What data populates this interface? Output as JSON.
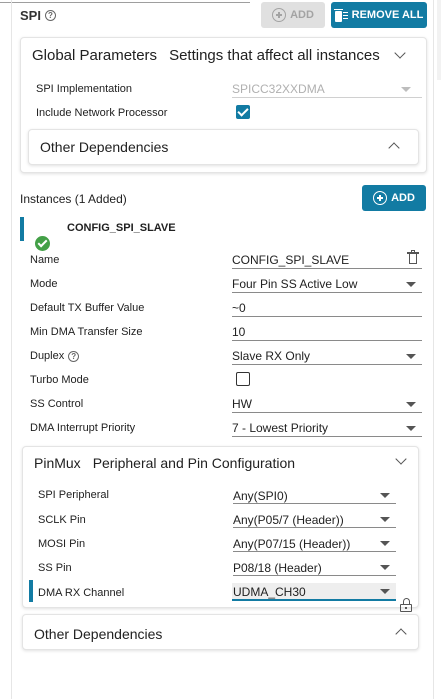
{
  "header": {
    "title": "SPI",
    "help_icon": "help-circle-icon",
    "add_button_label": "ADD",
    "remove_all_button_label": "REMOVE ALL"
  },
  "global_parameters": {
    "title": "Global Parameters",
    "subtitle": "Settings that affect all instances",
    "spi_impl_label": "SPI Implementation",
    "spi_impl_value": "SPICC32XXDMA",
    "include_np_label": "Include Network Processor",
    "include_np_checked": true,
    "other_dependencies_label": "Other Dependencies"
  },
  "instances": {
    "heading": "Instances (1 Added)",
    "add_label": "ADD",
    "selected_instance": "CONFIG_SPI_SLAVE",
    "status_icon": "check-circle-icon",
    "fields": {
      "name_label": "Name",
      "name_value": "CONFIG_SPI_SLAVE",
      "mode_label": "Mode",
      "mode_value": "Four Pin SS Active Low",
      "tx_buffer_label": "Default TX Buffer Value",
      "tx_buffer_value": "~0",
      "min_dma_label": "Min DMA Transfer Size",
      "min_dma_value": "10",
      "duplex_label": "Duplex",
      "duplex_value": "Slave RX Only",
      "turbo_label": "Turbo Mode",
      "turbo_checked": false,
      "ss_control_label": "SS Control",
      "ss_control_value": "HW",
      "dma_priority_label": "DMA Interrupt Priority",
      "dma_priority_value": "7 - Lowest Priority"
    }
  },
  "pinmux": {
    "title": "PinMux",
    "subtitle": "Peripheral and Pin Configuration",
    "spi_peripheral_label": "SPI Peripheral",
    "spi_peripheral_value": "Any(SPI0)",
    "sclk_label": "SCLK Pin",
    "sclk_value": "Any(P05/7 (Header))",
    "mosi_label": "MOSI Pin",
    "mosi_value": "Any(P07/15 (Header))",
    "ss_label": "SS Pin",
    "ss_value": "P08/18 (Header)",
    "dma_rx_label": "DMA RX Channel",
    "dma_rx_value": "UDMA_CH30"
  },
  "instance_other_dependencies_label": "Other Dependencies",
  "colors": {
    "accent": "#127ba3",
    "success": "#43a047",
    "disabled_button": "#e0e0e0"
  }
}
